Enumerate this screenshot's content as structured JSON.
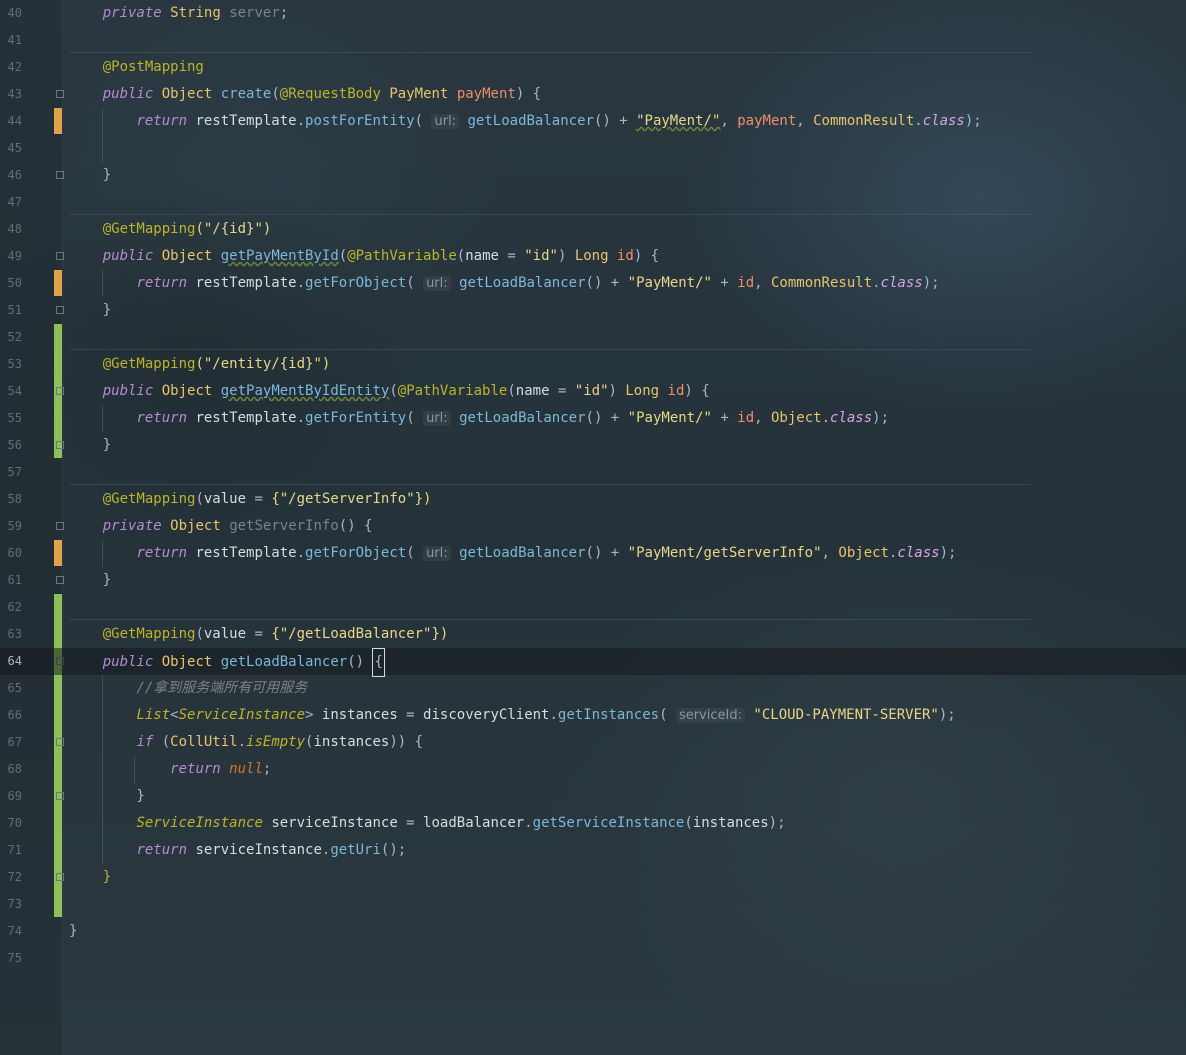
{
  "editor": {
    "current_line": 64,
    "lines": [
      {
        "n": "40"
      },
      {
        "n": "41"
      },
      {
        "n": "42"
      },
      {
        "n": "43"
      },
      {
        "n": "44"
      },
      {
        "n": "45"
      },
      {
        "n": "46"
      },
      {
        "n": "47"
      },
      {
        "n": "48"
      },
      {
        "n": "49"
      },
      {
        "n": "50"
      },
      {
        "n": "51"
      },
      {
        "n": "52"
      },
      {
        "n": "53"
      },
      {
        "n": "54"
      },
      {
        "n": "55"
      },
      {
        "n": "56"
      },
      {
        "n": "57"
      },
      {
        "n": "58"
      },
      {
        "n": "59"
      },
      {
        "n": "60"
      },
      {
        "n": "61"
      },
      {
        "n": "62"
      },
      {
        "n": "63"
      },
      {
        "n": "64"
      },
      {
        "n": "65"
      },
      {
        "n": "66"
      },
      {
        "n": "67"
      },
      {
        "n": "68"
      },
      {
        "n": "69"
      },
      {
        "n": "70"
      },
      {
        "n": "71"
      },
      {
        "n": "72"
      },
      {
        "n": "73"
      },
      {
        "n": "74"
      },
      {
        "n": "75"
      }
    ],
    "tokens": {
      "private": "private",
      "public": "public",
      "return": "return",
      "if": "if",
      "null": "null",
      "class": "class",
      "String": "String",
      "Object": "Object",
      "Long": "Long",
      "PayMent": "PayMent",
      "server": "server",
      "PostMapping": "@PostMapping",
      "GetMapping": "@GetMapping",
      "RequestBody": "@RequestBody",
      "PathVariable": "@PathVariable",
      "create": "create",
      "payMent": "payMent",
      "restTemplate": "restTemplate",
      "postForEntity": "postForEntity",
      "getForObject": "getForObject",
      "getForEntity": "getForEntity",
      "url_hint": "url:",
      "serviceId_hint": "serviceId:",
      "getLoadBalancer": "getLoadBalancer",
      "str_payment_slash": "\"PayMent/\"",
      "CommonResult": "CommonResult",
      "str_id_path": "(\"/{id}\")",
      "getPayMentById": "getPayMentById",
      "name": "name",
      "str_id": "\"id\"",
      "id": "id",
      "str_entity_path": "(\"/entity/{id}\")",
      "getPayMentByIdEntity": "getPayMentByIdEntity",
      "value": "value",
      "str_getServerInfo_path": "{\"/getServerInfo\"})",
      "getServerInfo": "getServerInfo",
      "str_payment_getServerInfo": "\"PayMent/getServerInfo\"",
      "str_getLoadBalancer_path": "{\"/getLoadBalancer\"})",
      "comment_get_services": "//拿到服务端所有可用服务",
      "List": "List",
      "ServiceInstance": "ServiceInstance",
      "instances": "instances",
      "discoveryClient": "discoveryClient",
      "getInstances": "getInstances",
      "str_cloud_payment": "\"CLOUD-PAYMENT-SERVER\"",
      "CollUtil": "CollUtil",
      "isEmpty": "isEmpty",
      "serviceInstance": "serviceInstance",
      "loadBalancer": "loadBalancer",
      "getServiceInstance": "getServiceInstance",
      "getUri": "getUri"
    }
  }
}
